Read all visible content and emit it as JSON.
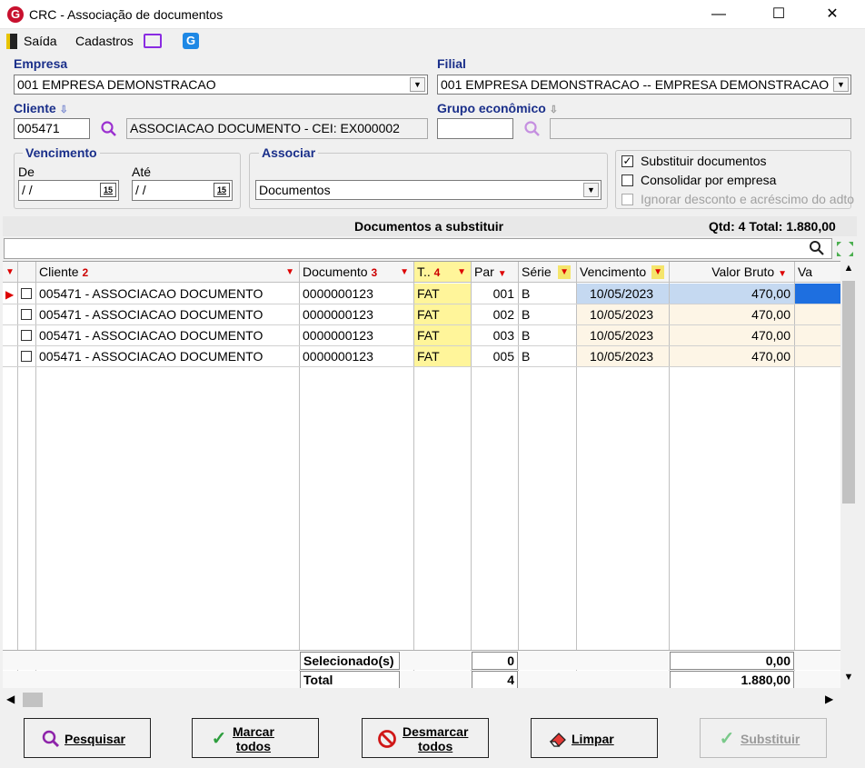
{
  "window": {
    "title": "CRC - Associação de documentos",
    "logo_letter": "G",
    "minimize": "—",
    "maximize": "☐",
    "close": "✕"
  },
  "menu": {
    "saida": "Saída",
    "cadastros": "Cadastros"
  },
  "form": {
    "empresa_label": "Empresa",
    "empresa_value": "001 EMPRESA DEMONSTRACAO",
    "filial_label": "Filial",
    "filial_value": "001 EMPRESA DEMONSTRACAO -- EMPRESA DEMONSTRACAO",
    "cliente_label": "Cliente",
    "cliente_code": "005471",
    "cliente_name": "ASSOCIACAO DOCUMENTO - CEI: EX000002",
    "grupo_label": "Grupo econômico",
    "grupo_code": "",
    "grupo_name": "",
    "vencimento_label": "Vencimento",
    "de_label": "De",
    "de_value": " / /",
    "ate_label": "Até",
    "ate_value": " / /",
    "calendar_glyph": "15",
    "associar_label": "Associar",
    "associar_value": "Documentos",
    "substituir_label": "Substituir documentos",
    "substituir_checked": true,
    "consolidar_label": "Consolidar por empresa",
    "consolidar_checked": false,
    "ignorar_label": "Ignorar desconto e acréscimo do adto",
    "ignorar_checked": false
  },
  "grid": {
    "title": "Documentos a substituir",
    "summary": "Qtd: 4 Total: 1.880,00",
    "columns": {
      "cliente": "Cliente",
      "cliente_sort": "2",
      "documento": "Documento",
      "documento_sort": "3",
      "tipo": "T..",
      "tipo_sort": "4",
      "par": "Par",
      "serie": "Série",
      "vencimento": "Vencimento",
      "valor_bruto": "Valor Bruto",
      "va": "Va"
    },
    "rows": [
      {
        "cliente": "005471 - ASSOCIACAO DOCUMENTO",
        "documento": "0000000123",
        "tipo": "FAT",
        "par": "001",
        "serie": "B",
        "vencimento": "10/05/2023",
        "valor": "470,00"
      },
      {
        "cliente": "005471 - ASSOCIACAO DOCUMENTO",
        "documento": "0000000123",
        "tipo": "FAT",
        "par": "002",
        "serie": "B",
        "vencimento": "10/05/2023",
        "valor": "470,00"
      },
      {
        "cliente": "005471 - ASSOCIACAO DOCUMENTO",
        "documento": "0000000123",
        "tipo": "FAT",
        "par": "003",
        "serie": "B",
        "vencimento": "10/05/2023",
        "valor": "470,00"
      },
      {
        "cliente": "005471 - ASSOCIACAO DOCUMENTO",
        "documento": "0000000123",
        "tipo": "FAT",
        "par": "005",
        "serie": "B",
        "vencimento": "10/05/2023",
        "valor": "470,00"
      }
    ],
    "footer": {
      "selecionados_label": "Selecionado(s)",
      "selecionados_count": "0",
      "selecionados_valor": "0,00",
      "total_label": "Total",
      "total_count": "4",
      "total_valor": "1.880,00"
    }
  },
  "buttons": {
    "pesquisar": "Pesquisar",
    "marcar_line1": "Marcar",
    "marcar_line2": "todos",
    "desmarcar_line1": "Desmarcar",
    "desmarcar_line2": "todos",
    "limpar": "Limpar",
    "substituir": "Substituir"
  },
  "colors": {
    "accent_label": "#1a2f8a",
    "highlight_yellow": "#fff59a",
    "filter_red": "#dd0000",
    "selected_blue": "#c5d9f1",
    "date_cell_bg": "#fdf5e6"
  }
}
